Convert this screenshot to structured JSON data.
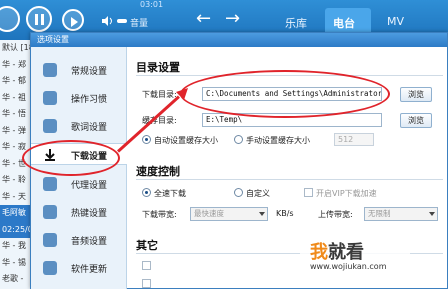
{
  "player": {
    "time": "03:01",
    "volume_label": "音量",
    "tabs": [
      "乐库",
      "电台",
      "MV"
    ],
    "active_tab": "电台"
  },
  "playlist": {
    "rows": [
      "默认 [182]",
      "华 - 郑",
      "华 - 郁",
      "华 - 祖",
      "华 - 悟",
      "华 - 弹",
      "华 - 寂",
      "华 - 世",
      "华 - 聆",
      "华 - 天",
      "毛阿敏",
      "02:25/0",
      "华 - 我",
      "华 - 锡",
      "老歌 -",
      "华 - 啊"
    ]
  },
  "dialog": {
    "title": "选项设置",
    "sidebar": [
      {
        "label": "常规设置",
        "icon": "gear-icon"
      },
      {
        "label": "操作习惯",
        "icon": "hand-icon"
      },
      {
        "label": "歌词设置",
        "icon": "lyrics-icon"
      },
      {
        "label": "下载设置",
        "icon": "download-icon",
        "active": true
      },
      {
        "label": "代理设置",
        "icon": "proxy-icon"
      },
      {
        "label": "热键设置",
        "icon": "keyboard-icon"
      },
      {
        "label": "音频设置",
        "icon": "audio-icon"
      },
      {
        "label": "软件更新",
        "icon": "update-icon"
      }
    ],
    "dir_section": {
      "title": "目录设置",
      "download_dir_label": "下载目录:",
      "download_dir_value": "C:\\Documents and Settings\\Administrator\\桌面",
      "cache_dir_label": "缓存目录:",
      "cache_dir_value": "E:\\Temp\\",
      "browse_label": "浏览",
      "auto_cache_label": "自动设置缓存大小",
      "manual_cache_label": "手动设置缓存大小",
      "cache_size": "512"
    },
    "speed_section": {
      "title": "速度控制",
      "full_speed_label": "全速下载",
      "custom_label": "自定义",
      "vip_label": "开启VIP下载加速",
      "download_bw_label": "下载带宽:",
      "download_bw_value": "最快速度",
      "unit": "KB/s",
      "upload_bw_label": "上传带宽:",
      "upload_bw_value": "无限制"
    },
    "other_section": {
      "title": "其它"
    }
  },
  "watermark": {
    "text_part1": "我",
    "text_part2": "就看",
    "url": "www.wojiukan.com"
  },
  "colors": {
    "accent": "#2c79c8",
    "annotation": "#e0242b"
  }
}
